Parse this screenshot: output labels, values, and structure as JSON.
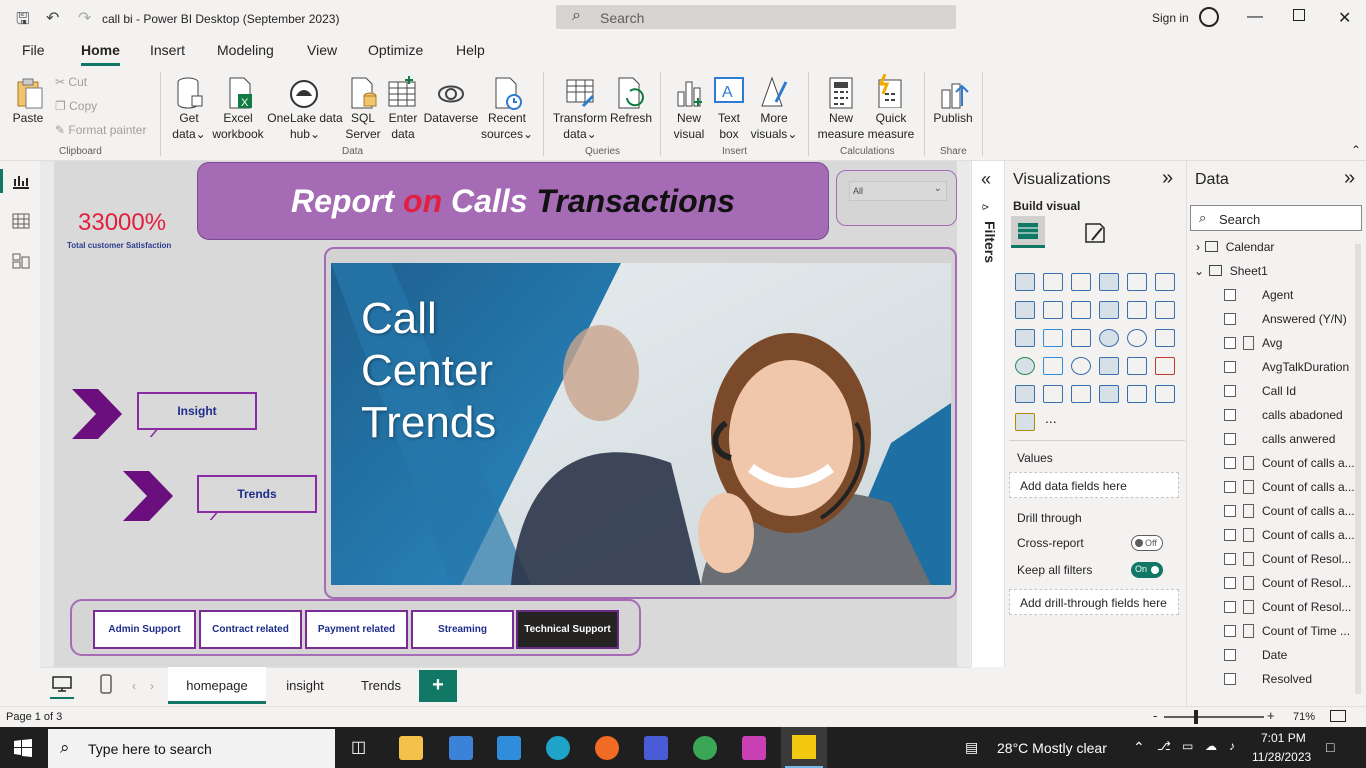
{
  "window": {
    "title": "call bi - Power BI Desktop (September 2023)",
    "search_placeholder": "Search",
    "sign_in": "Sign in"
  },
  "menu": {
    "tabs": [
      "File",
      "Home",
      "Insert",
      "Modeling",
      "View",
      "Optimize",
      "Help"
    ],
    "active": "Home"
  },
  "ribbon": {
    "clipboard": {
      "paste": "Paste",
      "cut": "Cut",
      "copy": "Copy",
      "format_painter": "Format painter",
      "group": "Clipboard"
    },
    "data": {
      "get_data": [
        "Get",
        "data"
      ],
      "excel": [
        "Excel",
        "workbook"
      ],
      "onelake": [
        "OneLake data",
        "hub"
      ],
      "sql": [
        "SQL",
        "Server"
      ],
      "enter": [
        "Enter",
        "data"
      ],
      "dataverse": "Dataverse",
      "recent": [
        "Recent",
        "sources"
      ],
      "group": "Data"
    },
    "queries": {
      "transform": [
        "Transform",
        "data"
      ],
      "refresh": "Refresh",
      "group": "Queries"
    },
    "insert": {
      "new_visual": [
        "New",
        "visual"
      ],
      "text_box": [
        "Text",
        "box"
      ],
      "more_visuals": [
        "More",
        "visuals"
      ],
      "group": "Insert"
    },
    "calculations": {
      "new_measure": [
        "New",
        "measure"
      ],
      "quick_measure": [
        "Quick",
        "measure"
      ],
      "group": "Calculations"
    },
    "share": {
      "publish": "Publish",
      "group": "Share"
    }
  },
  "report": {
    "title_parts": [
      "Report",
      "on",
      "Calls",
      "Transactions"
    ],
    "title_colors": [
      "#ffffff",
      "#e0203e",
      "#ffffff",
      "#111111"
    ],
    "slicer_value": "All",
    "kpi_value": "33000%",
    "kpi_label": "Total customer Satisfaction",
    "nav_insight": "Insight",
    "nav_trends": "Trends",
    "hero_text": [
      "Call",
      "Center",
      "Trends"
    ],
    "categories": [
      "Admin Support",
      "Contract related",
      "Payment related",
      "Streaming",
      "Technical Support"
    ],
    "selected_category": "Technical Support"
  },
  "filters_label": "Filters",
  "visualizations": {
    "title": "Visualizations",
    "build_visual": "Build visual",
    "values_label": "Values",
    "values_well": "Add data fields here",
    "drill_through": "Drill through",
    "cross_report": "Cross-report",
    "cross_report_state": "Off",
    "keep_all_filters": "Keep all filters",
    "keep_all_filters_state": "On",
    "drill_well": "Add drill-through fields here",
    "more": "..."
  },
  "data_pane": {
    "title": "Data",
    "search_placeholder": "Search",
    "tables": [
      "Calendar",
      "Sheet1"
    ],
    "fields": [
      {
        "name": "Agent",
        "calc": false
      },
      {
        "name": "Answered (Y/N)",
        "calc": false
      },
      {
        "name": "Avg",
        "calc": true
      },
      {
        "name": "AvgTalkDuration",
        "calc": false
      },
      {
        "name": "Call Id",
        "calc": false
      },
      {
        "name": "calls abadoned",
        "calc": false
      },
      {
        "name": "calls anwered",
        "calc": false
      },
      {
        "name": "Count of calls a...",
        "calc": true
      },
      {
        "name": "Count of calls a...",
        "calc": true
      },
      {
        "name": "Count of calls a...",
        "calc": true
      },
      {
        "name": "Count of calls a...",
        "calc": true
      },
      {
        "name": "Count of Resol...",
        "calc": true
      },
      {
        "name": "Count of Resol...",
        "calc": true
      },
      {
        "name": "Count of Resol...",
        "calc": true
      },
      {
        "name": "Count of Time ...",
        "calc": true
      },
      {
        "name": "Date",
        "calc": false
      },
      {
        "name": "Resolved",
        "calc": false
      }
    ]
  },
  "page_tabs": [
    "homepage",
    "insight",
    "Trends"
  ],
  "active_page": "homepage",
  "add_page": "+",
  "status": {
    "page": "Page 1 of 3",
    "zoom": "71%"
  },
  "taskbar": {
    "search_placeholder": "Type here to search",
    "weather": "28°C  Mostly clear",
    "time": "7:01 PM",
    "date": "11/28/2023"
  },
  "colors": {
    "accent": "#117865",
    "purple": "#a56bb5",
    "kpi": "#e0203e",
    "navy": "#1e2d8a"
  }
}
